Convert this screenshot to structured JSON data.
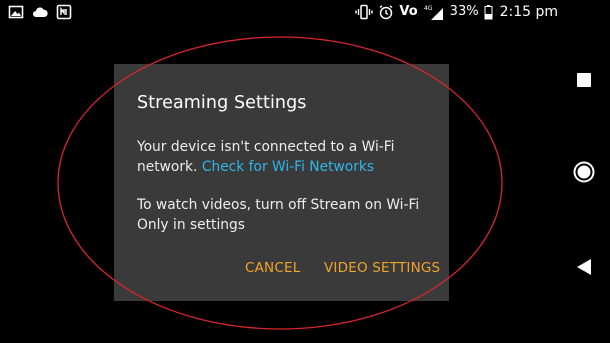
{
  "status_bar": {
    "left_icons": [
      "image-notification-icon",
      "cloud-notification-icon",
      "nfc-tag-icon"
    ],
    "right_icons": [
      "vibrate-icon",
      "alarm-icon",
      "volte-icon",
      "signal-4g-icon",
      "battery-icon"
    ],
    "volte_label": "Vo",
    "network_label": "4G",
    "battery_percent": "33%",
    "time": "2:15 pm"
  },
  "dialog": {
    "title": "Streaming Settings",
    "message1_prefix": "Your device isn't connected to a Wi-Fi network. ",
    "message1_link": "Check for Wi-Fi Networks",
    "message2": "To watch videos, turn off Stream on Wi-Fi Only in settings",
    "cancel_label": "CANCEL",
    "video_settings_label": "VIDEO SETTINGS"
  },
  "nav_bar": {
    "buttons": [
      "recents-icon",
      "home-icon",
      "back-icon"
    ]
  },
  "colors": {
    "background": "#000000",
    "dialog_bg": "#3a3a3a",
    "link": "#2fb6e9",
    "action": "#f0a42a",
    "annotation": "#d8262d"
  }
}
